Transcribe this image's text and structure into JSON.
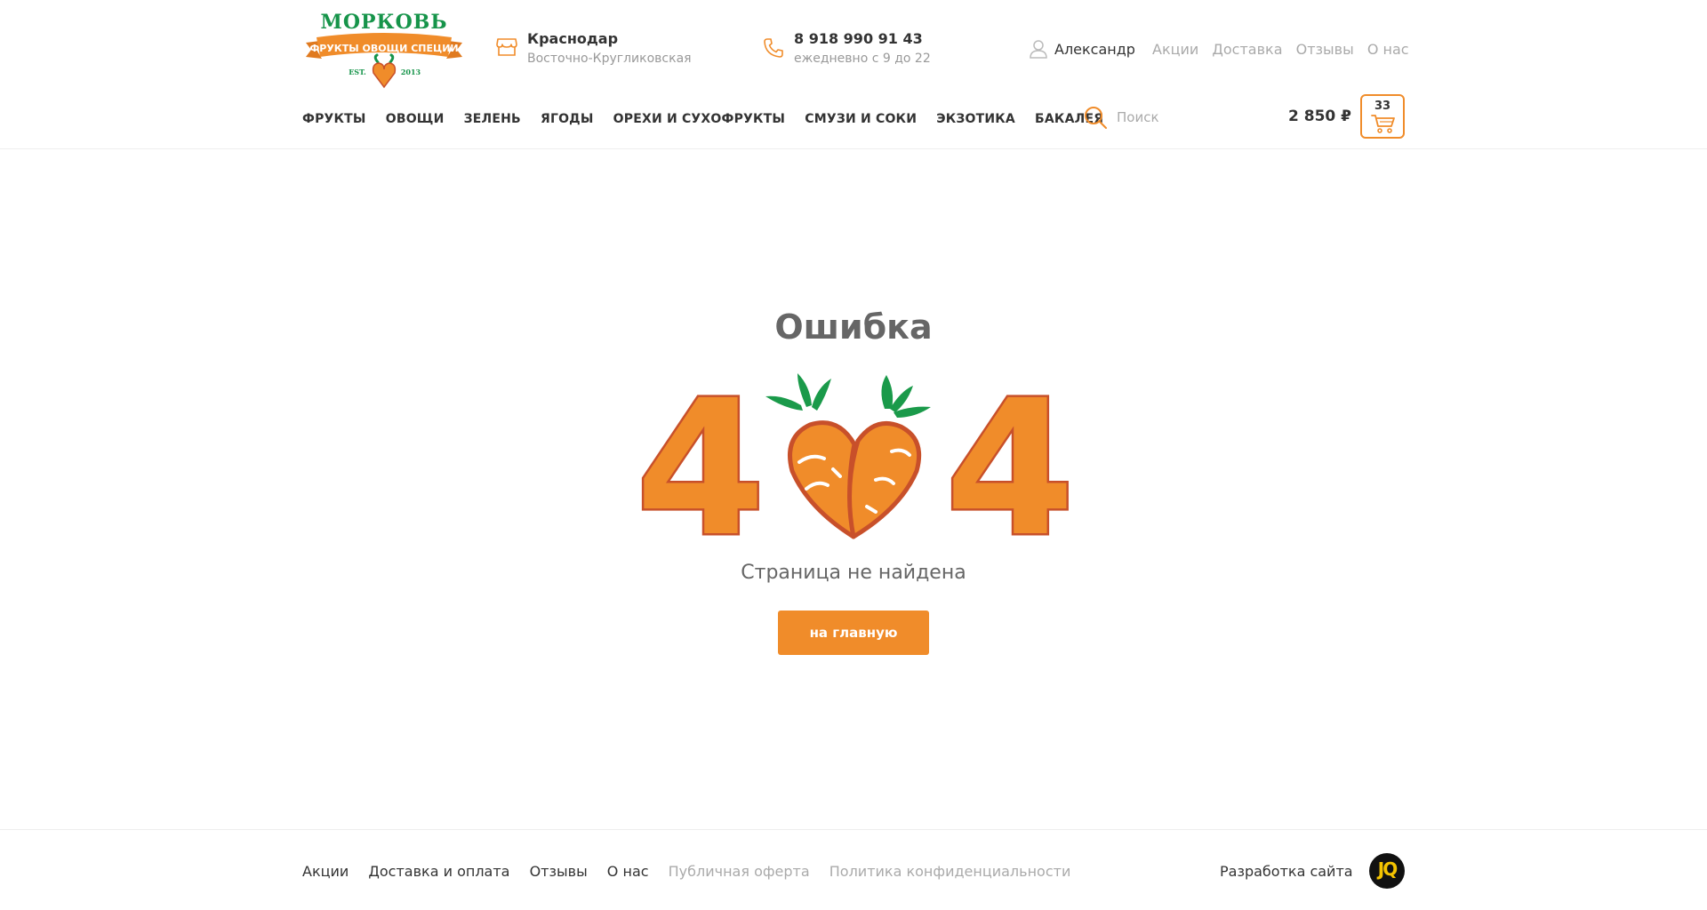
{
  "header": {
    "logo": {
      "title": "МОРКОВЬ",
      "ribbon": "ФРУКТЫ ОВОЩИ СПЕЦИИ",
      "est": "EST.",
      "year": "2013"
    },
    "store": {
      "city": "Краснодар",
      "address": "Восточно-Кругликовская",
      "icon": "store-icon"
    },
    "phone": {
      "number": "8 918 990 91 43",
      "hours": "ежедневно с 9 до 22",
      "icon": "phone-icon"
    },
    "user": {
      "name": "Александр",
      "icon": "user-icon"
    },
    "top_links": [
      "Акции",
      "Доставка",
      "Отзывы",
      "О нас"
    ],
    "nav": [
      "ФРУКТЫ",
      "ОВОЩИ",
      "ЗЕЛЕНЬ",
      "ЯГОДЫ",
      "ОРЕХИ И СУХОФРУКТЫ",
      "СМУЗИ И СОКИ",
      "ЭКЗОТИКА",
      "БАКАЛЕЯ"
    ],
    "search": {
      "placeholder": "Поиск",
      "value": "",
      "icon": "search-icon"
    },
    "cart": {
      "sum": "2 850 ₽",
      "count": "33",
      "icon": "cart-icon"
    }
  },
  "main": {
    "title": "Ошибка",
    "code_left": "4",
    "code_right": "4",
    "subtitle": "Страница не найдена",
    "button": "на главную"
  },
  "footer": {
    "links": [
      {
        "label": "Акции",
        "style": "dark"
      },
      {
        "label": "Доставка и оплата",
        "style": "dark"
      },
      {
        "label": "Отзывы",
        "style": "dark"
      },
      {
        "label": "О нас",
        "style": "dark"
      },
      {
        "label": "Публичная оферта",
        "style": "light"
      },
      {
        "label": "Политика конфиденциальности",
        "style": "light"
      }
    ],
    "developer_label": "Разработка сайта",
    "developer_logo": "JQ"
  },
  "colors": {
    "accent": "#f08c2a",
    "carrot_outline": "#c8502a",
    "leaf": "#1a9a4a",
    "text": "#333333",
    "muted": "#aaaaaa"
  }
}
